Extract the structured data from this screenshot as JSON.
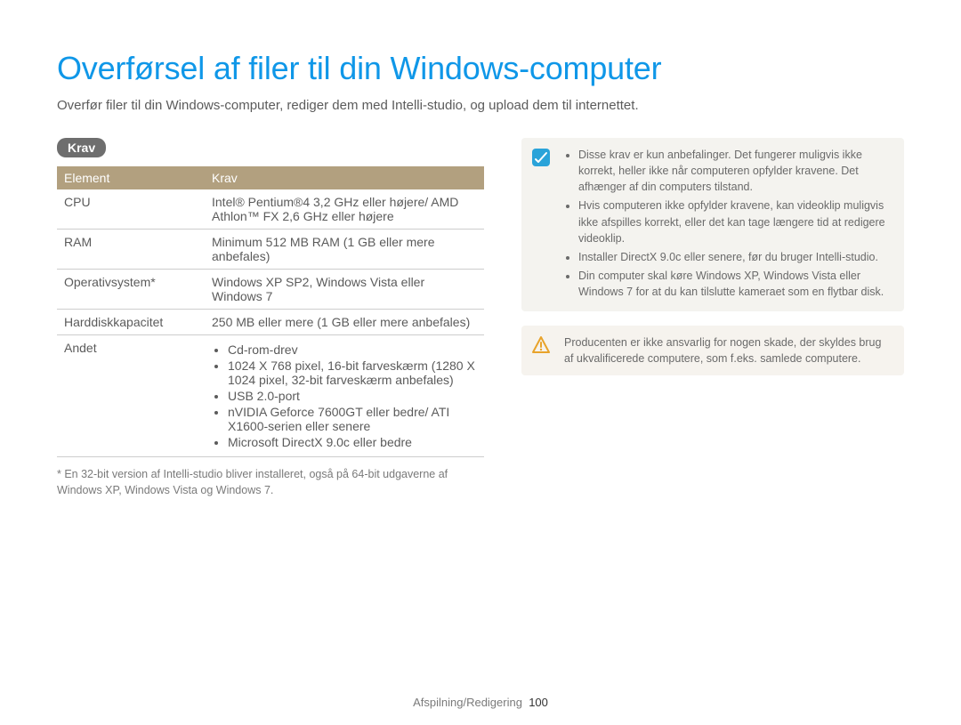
{
  "title": "Overførsel af filer til din Windows-computer",
  "intro": "Overfør filer til din Windows-computer, rediger dem med Intelli-studio, og upload dem til internettet.",
  "section_label": "Krav",
  "table": {
    "headers": {
      "col1": "Element",
      "col2": "Krav"
    },
    "cpu": {
      "label": "CPU",
      "value": "Intel® Pentium®4 3,2 GHz eller højere/ AMD Athlon™ FX 2,6 GHz eller højere"
    },
    "ram": {
      "label": "RAM",
      "value": "Minimum 512 MB RAM (1 GB eller mere anbefales)"
    },
    "os": {
      "label": "Operativsystem*",
      "value": "Windows XP SP2, Windows Vista eller Windows 7"
    },
    "hdd": {
      "label": "Harddiskkapacitet",
      "value": "250 MB eller mere (1 GB eller mere anbefales)"
    },
    "other": {
      "label": "Andet",
      "items": {
        "i1": "Cd-rom-drev",
        "i2": "1024 X 768 pixel, 16-bit farveskærm (1280 X 1024 pixel, 32-bit farveskærm anbefales)",
        "i3": "USB 2.0-port",
        "i4": "nVIDIA Geforce 7600GT eller bedre/ ATI X1600-serien eller senere",
        "i5": "Microsoft DirectX 9.0c eller bedre"
      }
    }
  },
  "footnote": "* En 32-bit version af Intelli-studio bliver installeret, også på 64-bit udgaverne af Windows XP, Windows Vista og Windows 7.",
  "note": {
    "i1": "Disse krav er kun anbefalinger. Det fungerer muligvis ikke korrekt, heller ikke når computeren opfylder kravene. Det afhænger af din computers tilstand.",
    "i2": "Hvis computeren ikke opfylder kravene, kan videoklip muligvis ikke afspilles korrekt, eller det kan tage længere tid at redigere videoklip.",
    "i3": "Installer DirectX 9.0c eller senere, før du bruger Intelli-studio.",
    "i4": "Din computer skal køre Windows XP, Windows Vista eller Windows 7 for at du kan tilslutte kameraet som en flytbar disk."
  },
  "warning": "Producenten er ikke ansvarlig for nogen skade, der skyldes brug af ukvalificerede computere, som f.eks. samlede computere.",
  "footer": {
    "section": "Afspilning/Redigering",
    "page": "100"
  }
}
